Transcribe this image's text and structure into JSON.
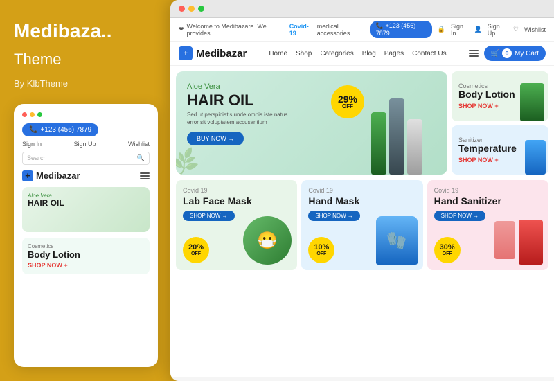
{
  "left": {
    "brand": "Medibaza..",
    "theme": "Theme",
    "by": "By KlbTheme",
    "mobile": {
      "phone": "+123 (456) 7879",
      "sign_in": "Sign In",
      "sign_up": "Sign Up",
      "wishlist": "Wishlist",
      "search_placeholder": "Search",
      "logo": "Medibazar",
      "hero_label": "Aloe Vera",
      "hero_title": "HAIR OIL",
      "cosmetics_label": "Cosmetics",
      "cosmetics_title": "Body Lotion",
      "shop_now": "SHOP NOW +"
    }
  },
  "site": {
    "topbar": {
      "welcome": "Welcome to Medibazare. We provides",
      "covid": "Covid-19",
      "medical": "medical accessories",
      "phone": "+123 (456) 7879",
      "sign_in": "Sign In",
      "sign_up": "Sign Up",
      "wishlist": "Wishlist"
    },
    "nav": {
      "logo": "Medibazar",
      "links": [
        "Home",
        "Shop",
        "Categories",
        "Blog",
        "Pages",
        "Contact Us"
      ],
      "cart_label": "My Cart",
      "cart_count": "0"
    },
    "hero": {
      "label": "Aloe Vera",
      "title_line1": "HAIR OIL",
      "description": "Sed ut perspiciatis unde omnis iste natus error sit voluptatem accusantium",
      "buy_now": "BUY NOW →",
      "badge_pct": "29%",
      "badge_off": "OFF"
    },
    "side_cards": [
      {
        "category": "Cosmetics",
        "title": "Body Lotion",
        "shop": "SHOP NOW +"
      },
      {
        "category": "Sanitizer",
        "title": "Temperature",
        "shop": "SHOP NOW +"
      }
    ],
    "products": [
      {
        "category": "Covid 19",
        "title": "Lab Face Mask",
        "shop": "SHOP NOW →",
        "discount": "20%",
        "off": "OFF"
      },
      {
        "category": "Covid 19",
        "title": "Hand Mask",
        "shop": "SHOP NOW →",
        "discount": "10%",
        "off": "OFF"
      },
      {
        "category": "Covid 19",
        "title": "Hand Sanitizer",
        "shop": "SHOP NOW →",
        "discount": "30%",
        "off": "OFF"
      }
    ]
  }
}
